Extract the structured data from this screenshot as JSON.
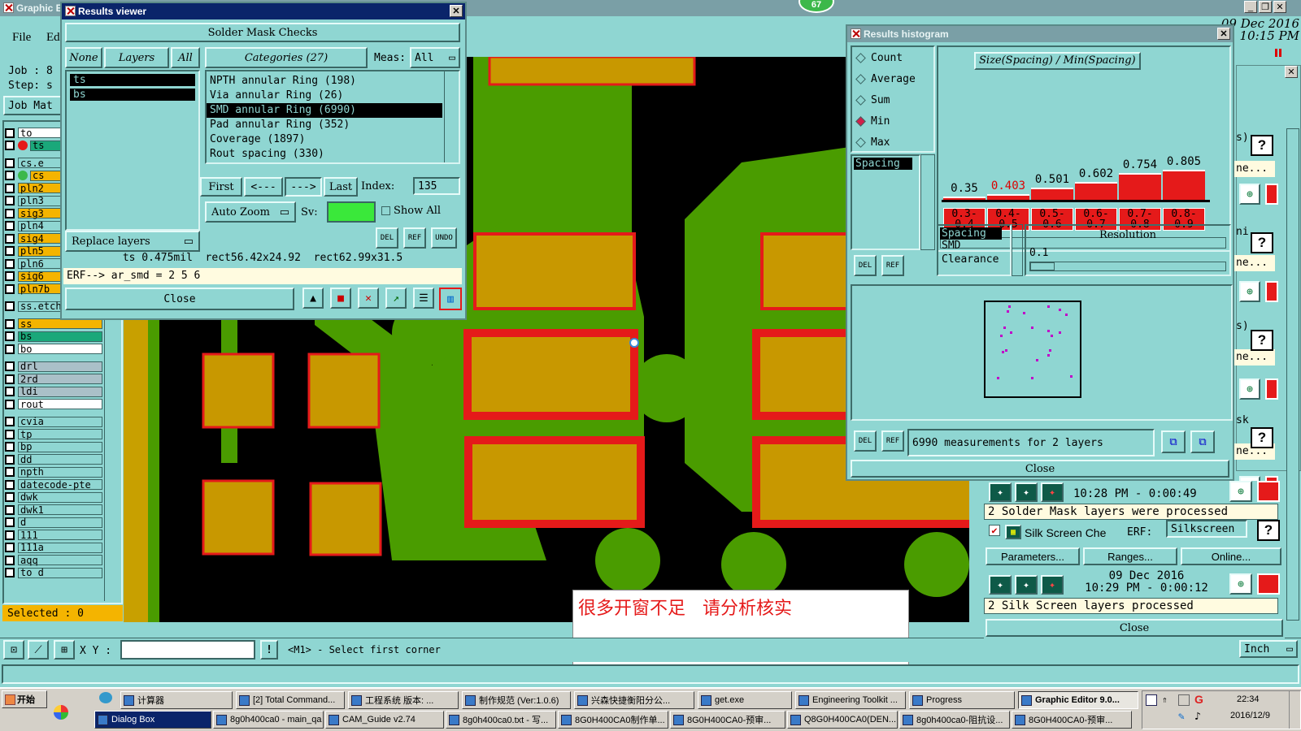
{
  "main": {
    "app_title": "Graphic E",
    "menu": {
      "file": "File",
      "edit": "Ed"
    },
    "job_label": "Job : 8",
    "step_label": "Step: s",
    "job_matrix": "Job Mat",
    "date": "09 Dec 2016",
    "time": "10:15 PM",
    "counter": "67",
    "layers": [
      {
        "name": "to",
        "color": "#ffffff"
      },
      {
        "name": "ts",
        "color": "#1aa87a",
        "active": true
      },
      {
        "name": "cs.e",
        "color": "#8fd6d2"
      },
      {
        "name": "cs",
        "color": "#f4b400",
        "active": true
      },
      {
        "name": "pln2",
        "color": "#f4b400"
      },
      {
        "name": "pln3",
        "color": "#8fd6d2"
      },
      {
        "name": "sig3",
        "color": "#f4b400"
      },
      {
        "name": "pln4",
        "color": "#8fd6d2"
      },
      {
        "name": "sig4",
        "color": "#f4b400"
      },
      {
        "name": "pln5",
        "color": "#f4b400"
      },
      {
        "name": "pln6",
        "color": "#8fd6d2"
      },
      {
        "name": "sig6",
        "color": "#f4b400"
      },
      {
        "name": "pln7b",
        "color": "#f4b400"
      },
      {
        "name": "ss.etch",
        "color": "#8fd6d2"
      },
      {
        "name": "ss",
        "color": "#f4b400"
      },
      {
        "name": "bs",
        "color": "#1aa87a"
      },
      {
        "name": "bo",
        "color": "#ffffff"
      },
      {
        "name": "drl",
        "color": "#aac0c8"
      },
      {
        "name": "2rd",
        "color": "#aac0c8"
      },
      {
        "name": "ldi",
        "color": "#aac0c8"
      },
      {
        "name": "rout",
        "color": "#ffffff"
      },
      {
        "name": "cvia",
        "color": "#8fd6d2"
      },
      {
        "name": "tp",
        "color": "#8fd6d2"
      },
      {
        "name": "bp",
        "color": "#8fd6d2"
      },
      {
        "name": "dd",
        "color": "#8fd6d2"
      },
      {
        "name": "npth",
        "color": "#8fd6d2"
      },
      {
        "name": "datecode-pte",
        "color": "#8fd6d2"
      },
      {
        "name": "dwk",
        "color": "#8fd6d2"
      },
      {
        "name": "dwk1",
        "color": "#8fd6d2"
      },
      {
        "name": "d",
        "color": "#8fd6d2"
      },
      {
        "name": "111",
        "color": "#8fd6d2"
      },
      {
        "name": "111a",
        "color": "#8fd6d2"
      },
      {
        "name": "aqq",
        "color": "#8fd6d2"
      },
      {
        "name": "to d",
        "color": "#8fd6d2"
      }
    ],
    "selected": "Selected : 0",
    "xy_label": "X Y :",
    "status_prompt": "<M1> - Select first corner",
    "unit": "Inch",
    "note": "很多开窗不足   请分析核实"
  },
  "results_viewer": {
    "title": "Results viewer",
    "heading": "Solder Mask Checks",
    "layer_buttons": [
      "None",
      "Layers",
      "All"
    ],
    "layers": [
      "ts",
      "bs"
    ],
    "categories_label": "Categories (27)",
    "meas_label": "Meas:",
    "meas_value": "All",
    "categories": [
      "NPTH annular Ring (198)",
      "Via annular Ring (26)",
      "SMD annular Ring (6990)",
      "Pad annular Ring (352)",
      "Coverage (1897)",
      "Rout spacing (330)"
    ],
    "selected_category": 2,
    "nav": {
      "first": "First",
      "prev": "<---",
      "next": "--->",
      "last": "Last",
      "index_label": "Index:",
      "index_value": "135"
    },
    "auto_zoom": "Auto Zoom",
    "sv_label": "Sv:",
    "show_all": "Show All",
    "replace_layers": "Replace layers",
    "icons": {
      "del": "DEL",
      "ref": "REF",
      "undo": "UNDO"
    },
    "info_line": "ts 0.475mil  rect56.42x24.92  rect62.99x31.5",
    "erf_line": "ERF--> ar_smd = 2 5 6",
    "close": "Close"
  },
  "histogram": {
    "title": "Results histogram",
    "options": [
      "Count",
      "Average",
      "Sum",
      "Min",
      "Max"
    ],
    "selected_option": "Min",
    "chart_title": "Size(Spacing) / Min(Spacing)",
    "left_list": [
      "Spacing"
    ],
    "chart_data": {
      "type": "bar",
      "categories": [
        "0.3-0.4",
        "0.4-0.5",
        "0.5-0.6",
        "0.6-0.7",
        "0.7-0.8",
        "0.8-0.9"
      ],
      "values": [
        0.35,
        0.403,
        0.501,
        0.602,
        0.754,
        0.805
      ],
      "highlight_index": 1,
      "title": "Size(Spacing) / Min(Spacing)"
    },
    "bucket_labels": [
      [
        "0.3-",
        "0.4"
      ],
      [
        "0.4-",
        "0.5"
      ],
      [
        "0.5-",
        "0.6"
      ],
      [
        "0.6-",
        "0.7"
      ],
      [
        "0.7-",
        "0.8"
      ],
      [
        "0.8-",
        "0.9"
      ]
    ],
    "types": [
      "Spacing",
      "SMD",
      "Clearance"
    ],
    "resolution_label": "Resolution",
    "resolution_value": "0.1",
    "measurements": "6990 measurements for 2 layers",
    "icons": {
      "del": "DEL",
      "ref": "REF"
    },
    "close": "Close"
  },
  "checklist": {
    "row1_time": "10:28 PM - 0:00:49",
    "row1_msg": "2 Solder Mask layers were processed",
    "silk_label": "Silk Screen Che",
    "erf_label": "ERF:",
    "erf_value": "Silkscreen",
    "params": "Parameters...",
    "ranges": "Ranges...",
    "online": "Online...",
    "row2_date": "09 Dec 2016",
    "row2_time": "10:29 PM - 0:00:12",
    "row2_msg": "2 Silk Screen layers processed",
    "close": "Close",
    "side_texts": [
      "s)",
      "ne...",
      "ni",
      "ne...",
      "s)",
      "ne...",
      "sk",
      "ne..."
    ]
  },
  "taskbar": {
    "start": "开始",
    "row1": [
      "计算器",
      "[2] Total Command...",
      "工程系统  版本: ...",
      "制作规范 (Ver:1.0.6)",
      "兴森快捷衡阳分公...",
      "get.exe",
      "Engineering Toolkit ...",
      "Progress",
      "Graphic Editor 9.0..."
    ],
    "row2": [
      "Dialog Box",
      "8g0h400ca0 - main_qa",
      "CAM_Guide v2.74",
      "8g0h400ca0.txt - 写...",
      "8G0H400CA0制作单...",
      "8G0H400CA0-预审...",
      "Q8G0H400CA0(DEN...",
      "8g0h400ca0-阻抗设...",
      "8G0H400CA0-预审..."
    ],
    "clock_time": "22:34",
    "clock_date": "2016/12/9"
  }
}
